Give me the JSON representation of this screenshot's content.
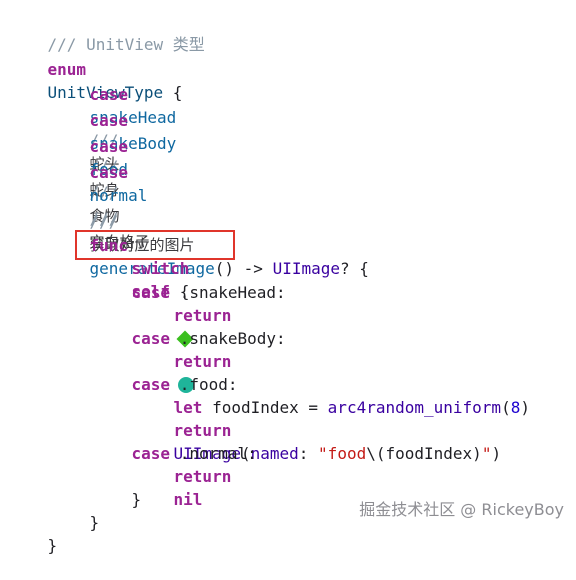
{
  "code": {
    "l1_comment": "/// UnitView 类型",
    "l2_kw": "enum",
    "l2_type": "UnitViewType",
    "l2_rest": " {",
    "case_kw": "case",
    "l3_name": "snakeHead",
    "l3_slash": "///",
    "l3_cjk": "蛇头",
    "l4_name": "snakeBody",
    "l4_slash": "///",
    "l4_cjk": "蛇身",
    "l5_name": "food",
    "l5_slash": "///",
    "l5_cjk": "食物",
    "l6_name": "normal",
    "l6_slash": "///",
    "l6_cjk": "空白格子",
    "l8_slash": "///",
    "l8_cjk": "获取对应的图片",
    "l9_kw": "func",
    "l9_name": "generateImage",
    "l9_mid": "() -> ",
    "l9_type": "UIImage",
    "l9_rest": "? {",
    "l10_kw": "switch",
    "l10_self": "self",
    "l10_rest": " {",
    "l11_rest": " .snakeHead:",
    "return_kw": "return",
    "l13_rest": " .snakeBody:",
    "l15_rest": " .food:",
    "l16_kw": "let",
    "l16_mid": " foodIndex = ",
    "l16_fn": "arc4random_uniform",
    "l16_open": "(",
    "l16_num": "8",
    "l16_close": ")",
    "l17_type": "UIImage",
    "l17_open": "(",
    "l17_label": "named",
    "l17_colon": ": ",
    "l17_str1": "\"food",
    "l17_interp": "\\(foodIndex)",
    "l17_str2": "\"",
    "l17_close": ")",
    "l18_rest": " .normal:",
    "l19_nil": "nil",
    "close_brace": "}"
  },
  "icons": {
    "snake_head": "green-diamond-icon",
    "snake_body": "teal-circle-icon"
  },
  "colors": {
    "keyword": "#9b2393",
    "type": "#0b4f79",
    "comment": "#8a99a6",
    "string": "#c41a16",
    "number": "#1c00cf",
    "highlight": "#e0352b",
    "diamond": "#3bbf1f",
    "circle": "#1fb49a"
  },
  "watermark": "掘金技术社区 @ RickeyBoy"
}
